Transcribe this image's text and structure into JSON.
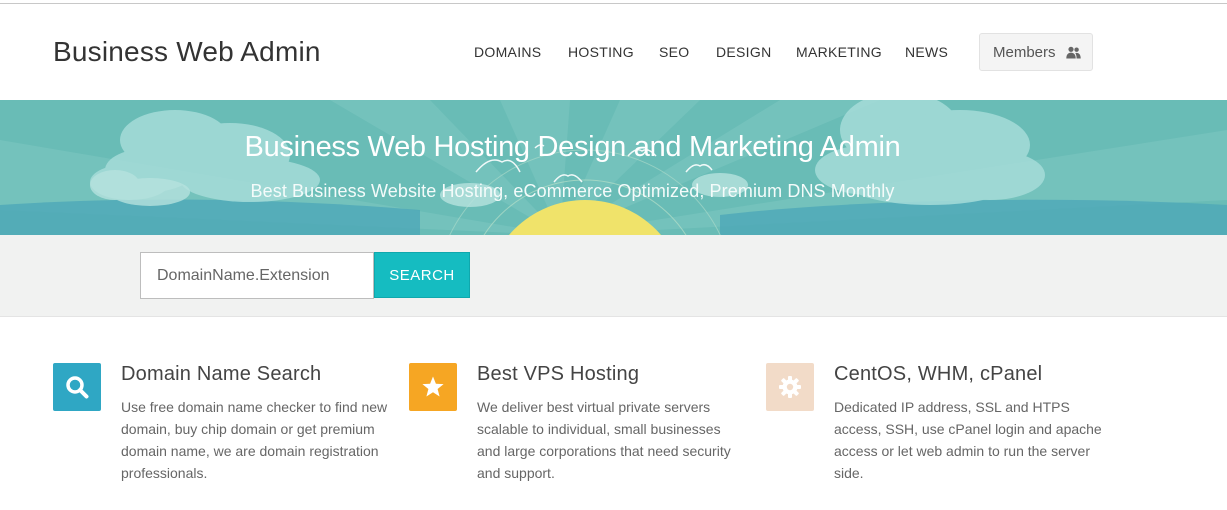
{
  "header": {
    "logo": "Business Web Admin",
    "nav": [
      "DOMAINS",
      "HOSTING",
      "SEO",
      "DESIGN",
      "MARKETING",
      "NEWS"
    ],
    "members_label": "Members",
    "members_icon": "users-icon"
  },
  "hero": {
    "title": "Business Web Hosting Design and Marketing Admin",
    "subtitle": "Best Business Website Hosting, eCommerce Optimized, Premium DNS Monthly"
  },
  "search": {
    "placeholder": "DomainName.Extension",
    "button_label": "SEARCH"
  },
  "features": [
    {
      "icon": "search-icon",
      "color": "#2fa7c4",
      "title": "Domain Name Search",
      "text": "Use free domain name checker to find new domain, buy chip domain or get premium domain name, we are domain registration professionals."
    },
    {
      "icon": "star-icon",
      "color": "#f6a623",
      "title": "Best VPS Hosting",
      "text": "We deliver best virtual private servers scalable to individual, small businesses and large corporations that need security and support."
    },
    {
      "icon": "gear-icon",
      "color": "#f2dbc8",
      "title": "CentOS, WHM, cPanel",
      "text": "Dedicated IP address, SSL and HTPS access, SSH, use cPanel login and apache access or let web admin to run the server side."
    }
  ],
  "colors": {
    "hero_bg": "#69bcb6",
    "search_button": "#15bcc1",
    "sun": "#f0e36a"
  }
}
